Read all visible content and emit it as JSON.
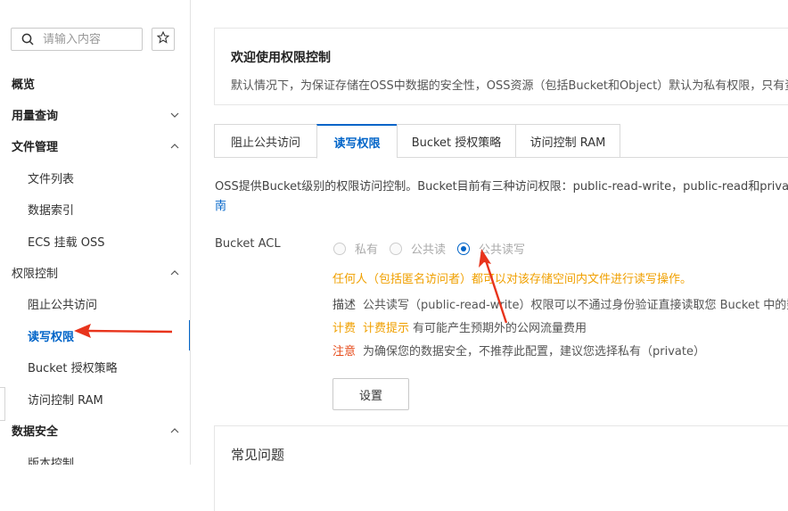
{
  "sidebar": {
    "search_placeholder": "请输入内容",
    "items": [
      {
        "label": "概览"
      },
      {
        "label": "用量查询"
      },
      {
        "label": "文件管理"
      },
      {
        "label": "文件列表"
      },
      {
        "label": "数据索引"
      },
      {
        "label": "ECS 挂载 OSS"
      },
      {
        "label": "权限控制"
      },
      {
        "label": "阻止公共访问"
      },
      {
        "label": "读写权限"
      },
      {
        "label": "Bucket 授权策略"
      },
      {
        "label": "访问控制 RAM"
      },
      {
        "label": "数据安全"
      },
      {
        "label": "版本控制"
      }
    ]
  },
  "welcome": {
    "title": "欢迎使用权限控制",
    "description": "默认情况下，为保证存储在OSS中数据的安全性，OSS资源（包括Bucket和Object）默认为私有权限，只有资"
  },
  "tabs": [
    {
      "label": "阻止公共访问"
    },
    {
      "label": "读写权限"
    },
    {
      "label": "Bucket 授权策略"
    },
    {
      "label": "访问控制 RAM"
    }
  ],
  "intro": {
    "text": "OSS提供Bucket级别的权限访问控制。Bucket目前有三种访问权限：public-read-write，public-read和private，",
    "link": "南"
  },
  "acl": {
    "label": "Bucket ACL",
    "options": [
      {
        "label": "私有"
      },
      {
        "label": "公共读"
      },
      {
        "label": "公共读写"
      }
    ],
    "selected": "公共读写",
    "warning": "任何人（包括匿名访问者）都可以对该存储空间内文件进行读写操作。",
    "details": {
      "desc_key": "描述",
      "desc_value": "公共读写（public-read-write）权限可以不通过身份验证直接读取您 Bucket 中的数",
      "fee_key": "计费",
      "fee_hint": "计费提示",
      "fee_value": "有可能产生预期外的公网流量费用",
      "note_key": "注意",
      "note_value": "为确保您的数据安全，不推荐此配置，建议您选择私有（private）"
    },
    "button": "设置"
  },
  "faq": {
    "title": "常见问题"
  },
  "colors": {
    "accent": "#0064c8",
    "warning": "#f0a000",
    "annotation": "#e8341c"
  }
}
